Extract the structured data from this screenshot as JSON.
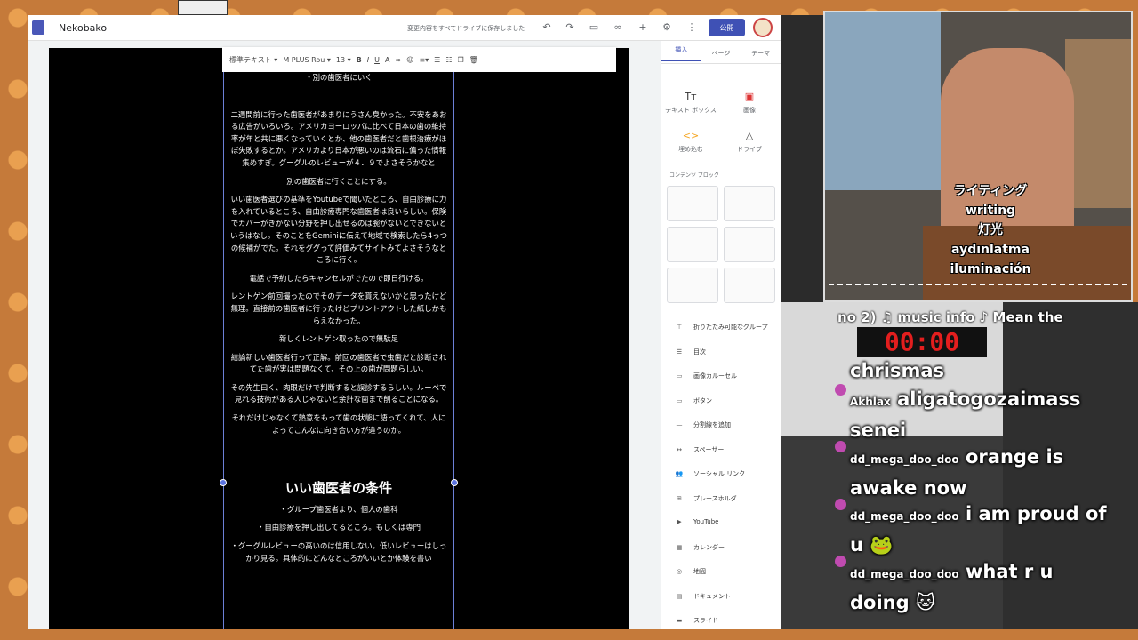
{
  "sites": {
    "title": "Nekobako",
    "save_status": "変更内容をすべてドライブに保存しました",
    "publish": "公開",
    "toolbar": {
      "style": "標準テキスト",
      "font": "M PLUS Rou",
      "size": "13"
    },
    "body": [
      "・別の歯医者にいく",
      "",
      "二週間前に行った歯医者があまりにうさん臭かった。不安をあおる広告がいろいろ。アメリカヨーロッパに比べて日本の歯の維持率が年と共に悪くなっていくとか、他の歯医者だと歯根治療がほぼ失敗するとか。アメリカより日本が悪いのは流石に偏った情報集めすぎ。グーグルのレビューが４．９でよさそうかなと",
      "別の歯医者に行くことにする。",
      "いい歯医者選びの基準をYoutubeで聞いたところ、自由診療に力を入れているところ、自由診療専門な歯医者は良いらしい。保険でカバーがきかない分野を押し出せるのは腕がないとできないというはなし。そのことをGeminiに伝えて地域で検索したら4っつの候補がでた。それをググって評価みてサイトみてよさそうなところに行く。",
      "電話で予約したらキャンセルがでたので即日行ける。",
      "レントゲン前回撮ったのでそのデータを貰えないかと思ったけど無理。直接前の歯医者に行ったけどプリントアウトした紙しかもらえなかった。",
      "新しくレントゲン取ったので無駄足",
      "結論新しい歯医者行って正解。前回の歯医者で虫歯だと診断されてた歯が実は問題なくて、その上の歯が問題らしい。",
      "その先生曰く、肉眼だけで判断すると誤診するらしい。ルーペで見れる技術がある人じゃないと余計な歯まで削ることになる。",
      "それだけじゃなくて熱意をもって歯の状態に語ってくれて、人によってこんなに向き合い方が違うのか。"
    ],
    "heading": "いい歯医者の条件",
    "list": [
      "・グループ歯医者より、個人の歯科",
      "・自由診療を押し出してるところ。もしくは専門",
      "・グーグルレビューの高いのは信用しない。低いレビューはしっかり見る。具体的にどんなところがいいとか体験を書い"
    ],
    "panel": {
      "tabs": [
        "挿入",
        "ページ",
        "テーマ"
      ],
      "tiles": [
        "テキスト ボックス",
        "画像",
        "埋め込む",
        "ドライブ"
      ],
      "content_blocks": "コンテンツ ブロック",
      "items": [
        "折りたたみ可能なグループ",
        "目次",
        "画像カルーセル",
        "ボタン",
        "分割線を追加",
        "スペーサー",
        "ソーシャル リンク",
        "プレースホルダ",
        "YouTube",
        "カレンダー",
        "地図",
        "ドキュメント",
        "スライド"
      ]
    }
  },
  "stream": {
    "subtitles": [
      "ライティング",
      "writing",
      "灯光",
      "aydınlatma",
      "iluminación"
    ],
    "music": "no 2)   ♫ music info ♪   Mean the",
    "timer": "00:00",
    "chat": [
      {
        "user": "",
        "text": "chrismas"
      },
      {
        "user": "Akhlax",
        "text": "aligatogozaimass senei"
      },
      {
        "user": "dd_mega_doo_doo",
        "text": "orange is awake now"
      },
      {
        "user": "dd_mega_doo_doo",
        "text": "i am proud of u 🐸"
      },
      {
        "user": "dd_mega_doo_doo",
        "text": "what r u doing 🐱"
      }
    ]
  }
}
